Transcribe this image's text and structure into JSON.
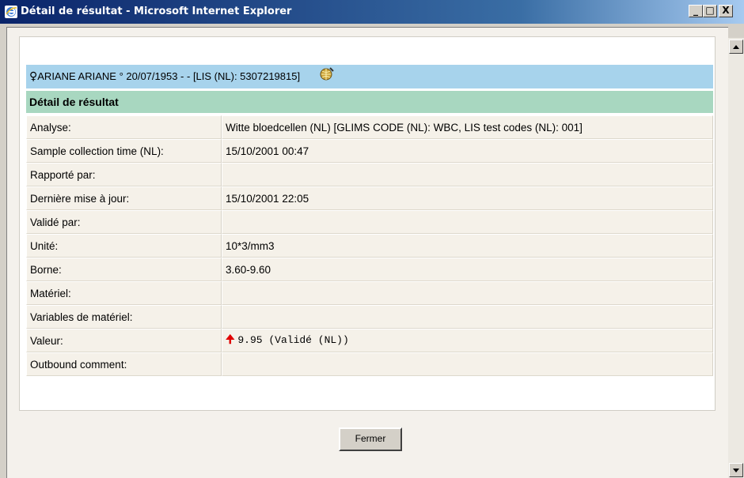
{
  "window": {
    "title": "Détail de résultat - Microsoft Internet Explorer",
    "minimize": "_",
    "maximize": "□",
    "close": "X"
  },
  "patient": {
    "sex_symbol": "♀",
    "info": "ARIANE ARIANE  ° 20/07/1953 - - [LIS (NL): 5307219815]"
  },
  "section": {
    "title": "Détail de résultat"
  },
  "rows": [
    {
      "label": "Analyse:",
      "value": "Witte bloedcellen (NL) [GLIMS CODE (NL): WBC, LIS test codes (NL): 001]"
    },
    {
      "label": "Sample collection time (NL):",
      "value": "15/10/2001 00:47"
    },
    {
      "label": "Rapporté par:",
      "value": ""
    },
    {
      "label": "Dernière mise à jour:",
      "value": "15/10/2001 22:05"
    },
    {
      "label": "Validé par:",
      "value": ""
    },
    {
      "label": "Unité:",
      "value": "10*3/mm3"
    },
    {
      "label": "Borne:",
      "value": "3.60-9.60"
    },
    {
      "label": "Matériel:",
      "value": ""
    },
    {
      "label": "Variables de matériel:",
      "value": ""
    },
    {
      "label": "Valeur:",
      "value": "9.95 (Validé (NL))",
      "flag": "up-arrow",
      "flag_color": "#e00000"
    },
    {
      "label": "Outbound comment:",
      "value": ""
    }
  ],
  "buttons": {
    "close_label": "Fermer"
  },
  "colors": {
    "titlebar_start": "#0a246a",
    "patient_bar": "#a7d3ec",
    "section_header": "#a8d7c0",
    "row_bg": "#f5f1e9"
  }
}
